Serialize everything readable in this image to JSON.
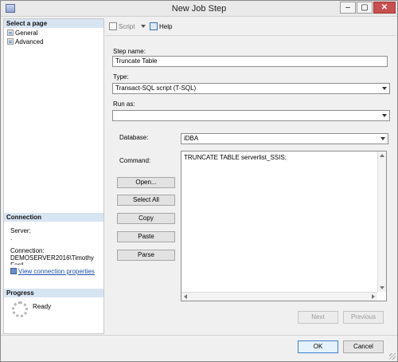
{
  "window": {
    "title": "New Job Step"
  },
  "titlebar": {
    "minimize": "–",
    "maximize": "▢",
    "close": "✕"
  },
  "sidebar": {
    "select_page_header": "Select a page",
    "pages": [
      {
        "label": "General",
        "icon": "page-icon"
      },
      {
        "label": "Advanced",
        "icon": "page-icon"
      }
    ],
    "connection_header": "Connection",
    "server_label": "Server:",
    "server_value": ".",
    "connection_label": "Connection:",
    "connection_value_line1": "DEMOSERVER2016\\Timothy",
    "connection_value_line2": "Ford",
    "view_connection_link": "View connection properties",
    "progress_header": "Progress",
    "progress_status": "Ready"
  },
  "toolbar": {
    "script_label": "Script",
    "help_label": "Help"
  },
  "form": {
    "step_name_label": "Step name:",
    "step_name_value": "Truncate Table",
    "type_label": "Type:",
    "type_value": "Transact-SQL script (T-SQL)",
    "run_as_label": "Run as:",
    "run_as_value": "",
    "database_label": "Database:",
    "database_value": "iDBA",
    "command_label": "Command:",
    "command_text": "TRUNCATE TABLE serverlist_SSIS;"
  },
  "command_buttons": {
    "open": "Open...",
    "select_all": "Select All",
    "copy": "Copy",
    "paste": "Paste",
    "parse": "Parse"
  },
  "nav_buttons": {
    "next": "Next",
    "previous": "Previous"
  },
  "footer": {
    "ok": "OK",
    "cancel": "Cancel"
  },
  "colors": {
    "pane_header": "#d7e4f2",
    "link": "#1a4fb0",
    "ok_border": "#3c7fd1",
    "close_button": "#c75050"
  }
}
